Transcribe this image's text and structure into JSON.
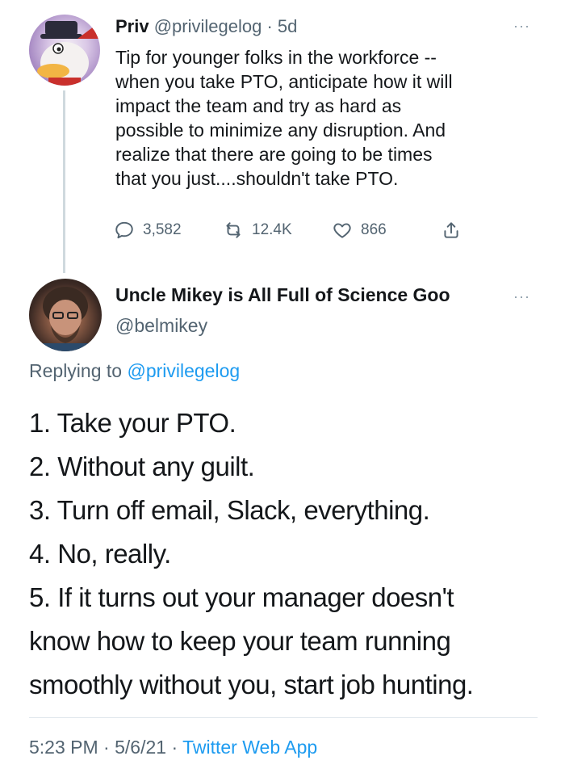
{
  "tweet1": {
    "display_name": "Priv",
    "handle": "@privilegelog",
    "separator": "·",
    "age": "5d",
    "more": "···",
    "lines": [
      "Tip for younger folks in the workforce --",
      "when you take PTO, anticipate how it will",
      "impact the team and try as hard as",
      "possible to minimize any disruption. And",
      "realize that there are going to be times",
      "that you just....shouldn't take PTO."
    ],
    "actions": {
      "replies": "3,582",
      "retweets": "12.4K",
      "likes": "866"
    },
    "icons": [
      "reply-icon",
      "retweet-icon",
      "like-icon",
      "share-icon"
    ]
  },
  "tweet2": {
    "display_name": "Uncle Mikey is All Full of Science Goo",
    "handle": "@belmikey",
    "more": "···",
    "replying_prefix": "Replying to",
    "replying_to": "@privilegelog",
    "lines": [
      "1. Take your PTO.",
      "2. Without any guilt.",
      "3. Turn off email, Slack, everything.",
      "4. No, really.",
      "5. If it turns out your manager doesn't",
      "know how to keep your team running",
      "smoothly without you, start job hunting."
    ],
    "time": "5:23 PM",
    "date": "5/6/21",
    "separator": "·",
    "source": "Twitter Web App"
  },
  "colors": {
    "text": "#14171a",
    "muted": "#536471",
    "link": "#1d9bf0"
  }
}
